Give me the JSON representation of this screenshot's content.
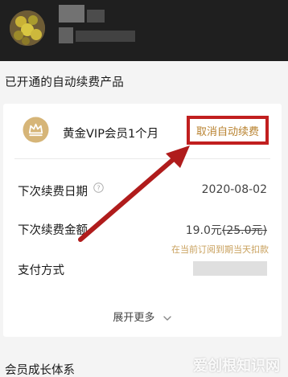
{
  "header": {
    "avatar_icon": "avatar-image",
    "username_blurred": true
  },
  "section": {
    "title": "已开通的自动续费产品"
  },
  "product": {
    "icon": "crown-icon",
    "name": "黄金VIP会员1个月",
    "cancel_label": "取消自动续费"
  },
  "rows": {
    "next_date_label": "下次续费日期",
    "next_date_value": "2020-08-02",
    "amount_label": "下次续费金额",
    "amount_value": "19.0元",
    "amount_original": "(25.0元)",
    "amount_note": "在当前订阅到期当天扣款",
    "payment_label": "支付方式"
  },
  "expand": {
    "label": "展开更多"
  },
  "bottom": {
    "title": "会员成长体系"
  },
  "watermark": {
    "text": "爱创根知识网"
  },
  "colors": {
    "header_bg": "#1f1f1f",
    "accent_gold": "#b8822f",
    "highlight_red": "#c11f1f",
    "note_gold": "#c9a15e"
  }
}
